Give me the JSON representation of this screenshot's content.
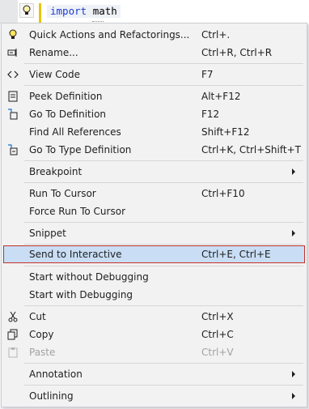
{
  "editor": {
    "keyword": "import",
    "module": "math"
  },
  "menu": {
    "items": [
      {
        "label": "Quick Actions and Refactorings...",
        "shortcut": "Ctrl+.",
        "icon": "lightbulb-icon"
      },
      {
        "label": "Rename...",
        "shortcut": "Ctrl+R, Ctrl+R",
        "icon": "rename-icon"
      },
      {
        "label": "View Code",
        "shortcut": "F7",
        "icon": "code-icon"
      },
      {
        "label": "Peek Definition",
        "shortcut": "Alt+F12",
        "icon": "peek-definition-icon"
      },
      {
        "label": "Go To Definition",
        "shortcut": "F12",
        "icon": "go-to-definition-icon"
      },
      {
        "label": "Find All References",
        "shortcut": "Shift+F12",
        "icon": ""
      },
      {
        "label": "Go To Type Definition",
        "shortcut": "Ctrl+K, Ctrl+Shift+T",
        "icon": "go-to-type-definition-icon"
      },
      {
        "label": "Breakpoint",
        "shortcut": "",
        "icon": ""
      },
      {
        "label": "Run To Cursor",
        "shortcut": "Ctrl+F10",
        "icon": ""
      },
      {
        "label": "Force Run To Cursor",
        "shortcut": "",
        "icon": ""
      },
      {
        "label": "Snippet",
        "shortcut": "",
        "icon": ""
      },
      {
        "label": "Send to Interactive",
        "shortcut": "Ctrl+E, Ctrl+E",
        "icon": ""
      },
      {
        "label": "Start without Debugging",
        "shortcut": "",
        "icon": ""
      },
      {
        "label": "Start with Debugging",
        "shortcut": "",
        "icon": ""
      },
      {
        "label": "Cut",
        "shortcut": "Ctrl+X",
        "icon": "cut-icon"
      },
      {
        "label": "Copy",
        "shortcut": "Ctrl+C",
        "icon": "copy-icon"
      },
      {
        "label": "Paste",
        "shortcut": "Ctrl+V",
        "icon": "paste-icon"
      },
      {
        "label": "Annotation",
        "shortcut": "",
        "icon": ""
      },
      {
        "label": "Outlining",
        "shortcut": "",
        "icon": ""
      }
    ]
  }
}
